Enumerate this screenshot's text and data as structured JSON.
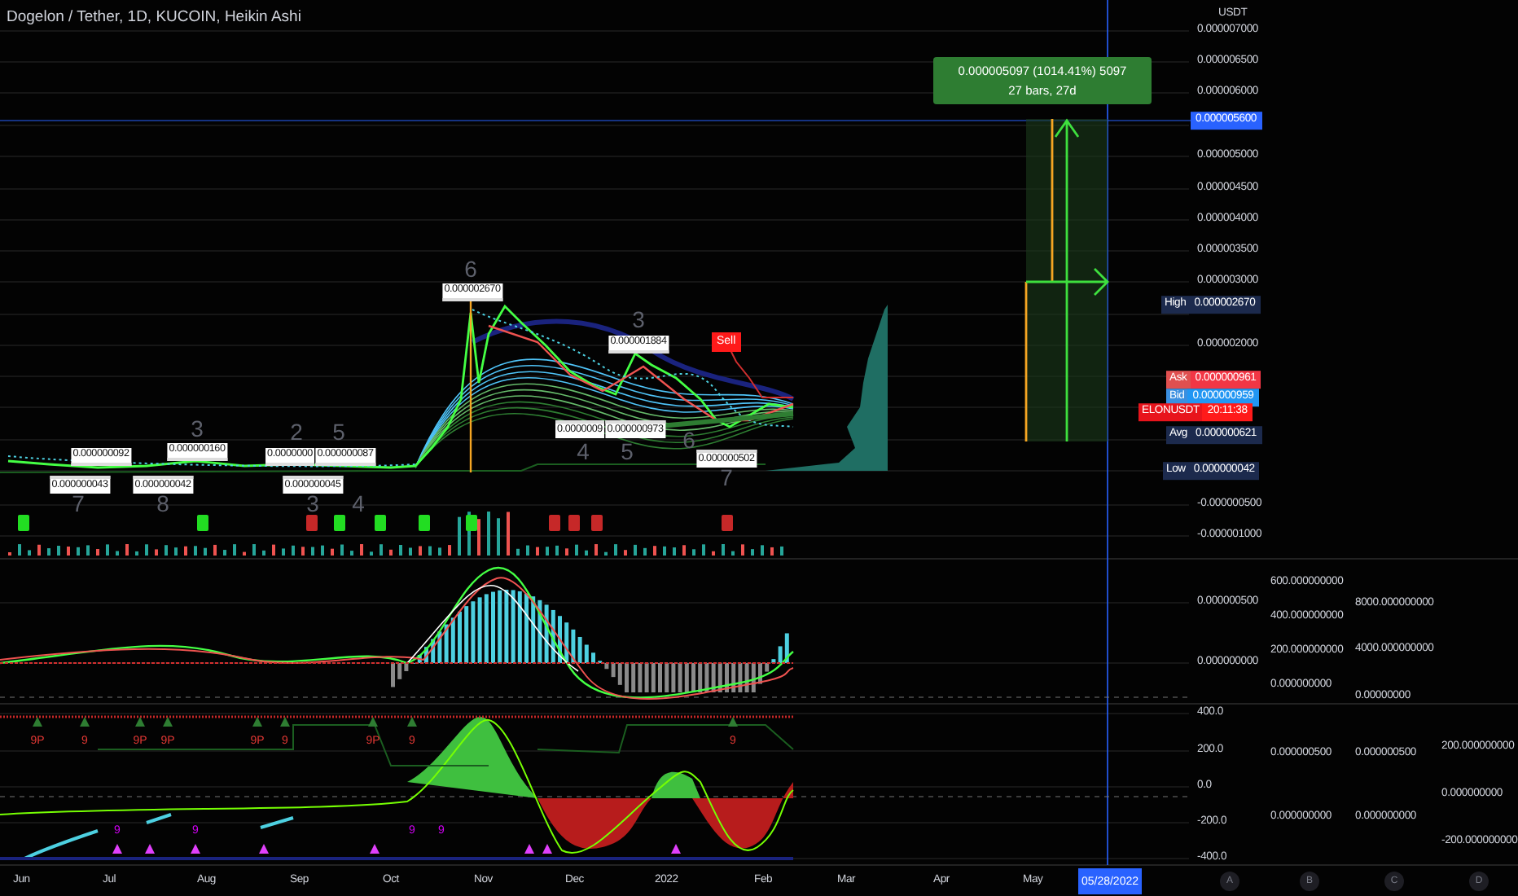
{
  "header": {
    "title": "Dogelon / Tether, 1D, KUCOIN, Heikin Ashi"
  },
  "price_axis": {
    "unit": "USDT",
    "ticks": [
      "0.000007000",
      "0.000006500",
      "0.000006000",
      "0.000005000",
      "0.000004500",
      "0.000004000",
      "0.000003500",
      "0.000003000",
      "0.000002000"
    ],
    "lower_ticks": [
      "-0.000000500",
      "-0.000001000"
    ]
  },
  "badges": [
    {
      "kind": "target",
      "value": "0.000005600"
    },
    {
      "kind": "high",
      "label": "High",
      "value": "0.000002670"
    },
    {
      "kind": "ask",
      "label": "Ask",
      "value": "0.000000961"
    },
    {
      "kind": "bid",
      "label": "Bid",
      "value": "0.000000959"
    },
    {
      "kind": "symbol",
      "label": "ELONUSDT",
      "value": "20:11:38"
    },
    {
      "kind": "avg",
      "label": "Avg",
      "value": "0.000000621"
    },
    {
      "kind": "low",
      "label": "Low",
      "value": "0.000000042"
    }
  ],
  "measure": {
    "value": "0.000005097 (1014.41%) 5097",
    "detail": "27 bars, 27d"
  },
  "wave_labels": [
    "6",
    "3",
    "2",
    "5",
    "3",
    "4",
    "5",
    "6",
    "7",
    "7",
    "8",
    "3",
    "4"
  ],
  "price_labels": [
    {
      "text": "0.000000092",
      "kind": "high"
    },
    {
      "text": "0.000000160",
      "kind": "high"
    },
    {
      "text": "0.0000000",
      "kind": "high"
    },
    {
      "text": "0.000000087",
      "kind": "high"
    },
    {
      "text": "0.000002670",
      "kind": "high"
    },
    {
      "text": "0.000001884",
      "kind": "high"
    },
    {
      "text": "0.000000043",
      "kind": "low"
    },
    {
      "text": "0.000000042",
      "kind": "low"
    },
    {
      "text": "0.000000045",
      "kind": "low"
    },
    {
      "text": "0.0000009",
      "kind": "low"
    },
    {
      "text": "0.000000973",
      "kind": "low"
    },
    {
      "text": "0.000000502",
      "kind": "low"
    }
  ],
  "sell_signal": {
    "label": "Sell"
  },
  "signal_labels": [
    {
      "text": "9P",
      "kind": "bearish"
    },
    {
      "text": "9",
      "kind": "bearish"
    },
    {
      "text": "9P",
      "kind": "bearish"
    },
    {
      "text": "9P",
      "kind": "bearish"
    },
    {
      "text": "9P",
      "kind": "bearish"
    },
    {
      "text": "9",
      "kind": "bearish"
    },
    {
      "text": "9P",
      "kind": "bearish"
    },
    {
      "text": "9",
      "kind": "bearish"
    },
    {
      "text": "9",
      "kind": "bearish"
    },
    {
      "text": "9",
      "kind": "bullish"
    },
    {
      "text": "9",
      "kind": "bullish"
    },
    {
      "text": "9",
      "kind": "bullish"
    },
    {
      "text": "9",
      "kind": "bullish"
    }
  ],
  "pane_a_ticks": [
    "0.000000500",
    "0.000000000"
  ],
  "pane_c_ticks": [
    "400.0",
    "200.0",
    "0.0",
    "-200.0",
    "-400.0"
  ],
  "scale_b_ticks": [
    "600.000000000",
    "400.000000000",
    "200.000000000",
    "0.000000000",
    "0.000000500",
    "0.000000000"
  ],
  "scale_c_ticks": [
    "8000.000000000",
    "4000.000000000",
    "0.00000000",
    "0.000000500",
    "0.000000000"
  ],
  "scale_d_ticks": [
    "200.000000000",
    "0.000000000",
    "-200.000000000"
  ],
  "time_axis": {
    "months": [
      "Jun",
      "Jul",
      "Aug",
      "Sep",
      "Oct",
      "Nov",
      "Dec",
      "2022",
      "Feb",
      "Mar",
      "Apr",
      "May"
    ],
    "cursor_date": "05/28/2022"
  },
  "scale_buttons": [
    "A",
    "B",
    "C",
    "D"
  ]
}
